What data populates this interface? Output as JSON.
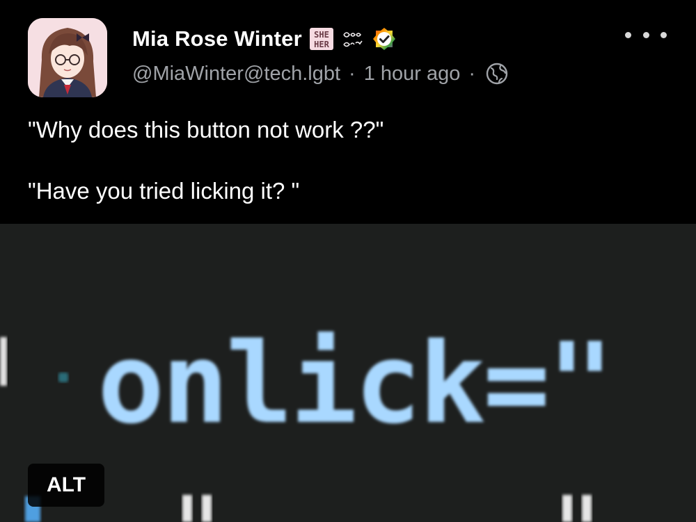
{
  "post": {
    "author": {
      "display_name": "Mia Rose Winter",
      "handle": "@MiaWinter@tech.lgbt",
      "emoji_badges": [
        "she-her-emoji",
        "good-girl-emoji",
        "verified-rainbow-icon"
      ]
    },
    "meta": {
      "separator": "·",
      "time": "1 hour ago",
      "visibility_icon": "globe-icon"
    },
    "more_icon": "ellipsis-icon",
    "text_lines": [
      "\"Why does this button not work ??\"",
      "\"Have you tried licking it? \""
    ]
  },
  "media": {
    "code_text": "onlick=\"",
    "alt_label": "ALT"
  },
  "colors": {
    "background": "#000000",
    "muted_text": "#a0a3a8",
    "media_bg": "#1d1f1e",
    "code_text": "#a9d8ff",
    "code_operator": "#e8e8e8"
  }
}
